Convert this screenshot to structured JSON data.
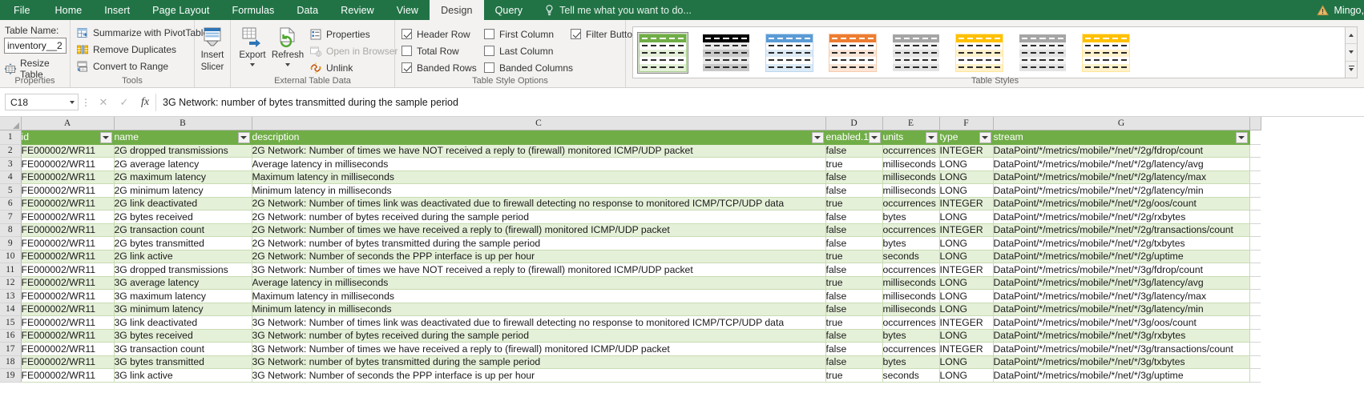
{
  "app": {
    "account_name": "Mingo,",
    "warning_icon": "warning-triangle-icon"
  },
  "tabs": [
    {
      "label": "File",
      "active": false
    },
    {
      "label": "Home",
      "active": false
    },
    {
      "label": "Insert",
      "active": false
    },
    {
      "label": "Page Layout",
      "active": false
    },
    {
      "label": "Formulas",
      "active": false
    },
    {
      "label": "Data",
      "active": false
    },
    {
      "label": "Review",
      "active": false
    },
    {
      "label": "View",
      "active": false
    },
    {
      "label": "Design",
      "active": true
    },
    {
      "label": "Query",
      "active": false
    }
  ],
  "tell_me": {
    "text": "Tell me what you want to do...",
    "icon": "lightbulb-icon"
  },
  "ribbon": {
    "properties": {
      "group_label": "Properties",
      "table_name_label": "Table Name:",
      "table_name_value": "inventory__2",
      "resize_table": "Resize Table"
    },
    "tools": {
      "group_label": "Tools",
      "items": [
        {
          "label": "Summarize with PivotTable",
          "icon": "pivottable-icon"
        },
        {
          "label": "Remove Duplicates",
          "icon": "remove-duplicates-icon"
        },
        {
          "label": "Convert to Range",
          "icon": "convert-to-range-icon"
        }
      ]
    },
    "slicer": {
      "label_line1": "Insert",
      "label_line2": "Slicer",
      "icon": "insert-slicer-icon"
    },
    "external_data": {
      "group_label": "External Table Data",
      "export": "Export",
      "refresh": "Refresh",
      "properties": "Properties",
      "open_in_browser": "Open in Browser",
      "unlink": "Unlink"
    },
    "style_options": {
      "group_label": "Table Style Options",
      "items": [
        {
          "label": "Header Row",
          "checked": true
        },
        {
          "label": "First Column",
          "checked": false
        },
        {
          "label": "Filter Button",
          "checked": true
        },
        {
          "label": "Total Row",
          "checked": false
        },
        {
          "label": "Last Column",
          "checked": false
        },
        {
          "label": "Banded Rows",
          "checked": true
        },
        {
          "label": "Banded Columns",
          "checked": false
        }
      ]
    },
    "table_styles": {
      "group_label": "Table Styles",
      "swatches": [
        {
          "name": "green",
          "header": "#70ad47",
          "band": "#e5f0d8",
          "alt": "#ffffff",
          "border": "#a9d08e",
          "selected": true
        },
        {
          "name": "black",
          "header": "#000000",
          "band": "#c9c9c9",
          "alt": "#e9e9e9",
          "border": "#ffffff",
          "selected": false
        },
        {
          "name": "blue",
          "header": "#5b9bd5",
          "band": "#ddebf7",
          "alt": "#ffffff",
          "border": "#bdd7ee",
          "selected": false
        },
        {
          "name": "orange",
          "header": "#ed7d31",
          "band": "#fbe5d6",
          "alt": "#ffffff",
          "border": "#f8cbad",
          "selected": false
        },
        {
          "name": "gray",
          "header": "#a5a5a5",
          "band": "#e3e3e3",
          "alt": "#f2f2f2",
          "border": "#ffffff",
          "selected": false
        },
        {
          "name": "yellow",
          "header": "#ffc000",
          "band": "#fff2cc",
          "alt": "#ffffff",
          "border": "#ffe699",
          "selected": false
        },
        {
          "name": "gray2",
          "header": "#a5a5a5",
          "band": "#e3e3e3",
          "alt": "#f2f2f2",
          "border": "#ffffff",
          "selected": false
        },
        {
          "name": "yellow2",
          "header": "#ffc000",
          "band": "#fff2cc",
          "alt": "#ffffff",
          "border": "#ffe699",
          "selected": false
        }
      ]
    }
  },
  "formula_bar": {
    "name_box": "C18",
    "cancel_icon": "cancel-icon",
    "confirm_icon": "confirm-icon",
    "function_icon": "fx-icon",
    "value": "3G Network: number of bytes transmitted during the sample period"
  },
  "grid": {
    "column_letters": [
      "A",
      "B",
      "C",
      "D",
      "E",
      "F",
      "G"
    ],
    "row_numbers": [
      1,
      2,
      3,
      4,
      5,
      6,
      7,
      8,
      9,
      10,
      11,
      12,
      13,
      14,
      15,
      16,
      17,
      18,
      19
    ],
    "headers": [
      "id",
      "name",
      "description",
      "enabled.1",
      "units",
      "type",
      "stream"
    ],
    "rows": [
      [
        "FE000002/WR11",
        "2G dropped transmissions",
        "2G Network: Number of times we have NOT received a reply to (firewall) monitored ICMP/UDP packet",
        "false",
        "occurrences",
        "INTEGER",
        "DataPoint/*/metrics/mobile/*/net/*/2g/fdrop/count"
      ],
      [
        "FE000002/WR11",
        "2G average latency",
        "Average latency in milliseconds",
        "true",
        "milliseconds",
        "LONG",
        "DataPoint/*/metrics/mobile/*/net/*/2g/latency/avg"
      ],
      [
        "FE000002/WR11",
        "2G maximum latency",
        "Maximum latency in milliseconds",
        "false",
        "milliseconds",
        "LONG",
        "DataPoint/*/metrics/mobile/*/net/*/2g/latency/max"
      ],
      [
        "FE000002/WR11",
        "2G minimum latency",
        "Minimum latency in milliseconds",
        "false",
        "milliseconds",
        "LONG",
        "DataPoint/*/metrics/mobile/*/net/*/2g/latency/min"
      ],
      [
        "FE000002/WR11",
        "2G link deactivated",
        "2G Network: Number of times link was deactivated due to firewall detecting no response to monitored ICMP/TCP/UDP data",
        "true",
        "occurrences",
        "INTEGER",
        "DataPoint/*/metrics/mobile/*/net/*/2g/oos/count"
      ],
      [
        "FE000002/WR11",
        "2G bytes received",
        "2G Network: number of bytes received during the sample period",
        "false",
        "bytes",
        "LONG",
        "DataPoint/*/metrics/mobile/*/net/*/2g/rxbytes"
      ],
      [
        "FE000002/WR11",
        "2G transaction count",
        "2G Network: Number of times we have received a reply to (firewall) monitored ICMP/UDP packet",
        "false",
        "occurrences",
        "INTEGER",
        "DataPoint/*/metrics/mobile/*/net/*/2g/transactions/count"
      ],
      [
        "FE000002/WR11",
        "2G bytes transmitted",
        "2G Network: number of bytes transmitted during the sample period",
        "false",
        "bytes",
        "LONG",
        "DataPoint/*/metrics/mobile/*/net/*/2g/txbytes"
      ],
      [
        "FE000002/WR11",
        "2G link active",
        "2G Network: Number of seconds the PPP interface is up per hour",
        "true",
        "seconds",
        "LONG",
        "DataPoint/*/metrics/mobile/*/net/*/2g/uptime"
      ],
      [
        "FE000002/WR11",
        "3G dropped transmissions",
        "3G Network: Number of times we have NOT received a reply to (firewall) monitored ICMP/UDP packet",
        "false",
        "occurrences",
        "INTEGER",
        "DataPoint/*/metrics/mobile/*/net/*/3g/fdrop/count"
      ],
      [
        "FE000002/WR11",
        "3G average latency",
        "Average latency in milliseconds",
        "true",
        "milliseconds",
        "LONG",
        "DataPoint/*/metrics/mobile/*/net/*/3g/latency/avg"
      ],
      [
        "FE000002/WR11",
        "3G maximum latency",
        "Maximum latency in milliseconds",
        "false",
        "milliseconds",
        "LONG",
        "DataPoint/*/metrics/mobile/*/net/*/3g/latency/max"
      ],
      [
        "FE000002/WR11",
        "3G minimum latency",
        "Minimum latency in milliseconds",
        "false",
        "milliseconds",
        "LONG",
        "DataPoint/*/metrics/mobile/*/net/*/3g/latency/min"
      ],
      [
        "FE000002/WR11",
        "3G link deactivated",
        "3G Network: Number of times link was deactivated due to firewall detecting no response to monitored ICMP/TCP/UDP data",
        "true",
        "occurrences",
        "INTEGER",
        "DataPoint/*/metrics/mobile/*/net/*/3g/oos/count"
      ],
      [
        "FE000002/WR11",
        "3G bytes received",
        "3G Network: number of bytes received during the sample period",
        "false",
        "bytes",
        "LONG",
        "DataPoint/*/metrics/mobile/*/net/*/3g/rxbytes"
      ],
      [
        "FE000002/WR11",
        "3G transaction count",
        "3G Network: Number of times we have received a reply to (firewall) monitored ICMP/UDP packet",
        "false",
        "occurrences",
        "INTEGER",
        "DataPoint/*/metrics/mobile/*/net/*/3g/transactions/count"
      ],
      [
        "FE000002/WR11",
        "3G bytes transmitted",
        "3G Network: number of bytes transmitted during the sample period",
        "false",
        "bytes",
        "LONG",
        "DataPoint/*/metrics/mobile/*/net/*/3g/txbytes"
      ],
      [
        "FE000002/WR11",
        "3G link active",
        "3G Network: Number of seconds the PPP interface is up per hour",
        "true",
        "seconds",
        "LONG",
        "DataPoint/*/metrics/mobile/*/net/*/3g/uptime"
      ]
    ]
  }
}
